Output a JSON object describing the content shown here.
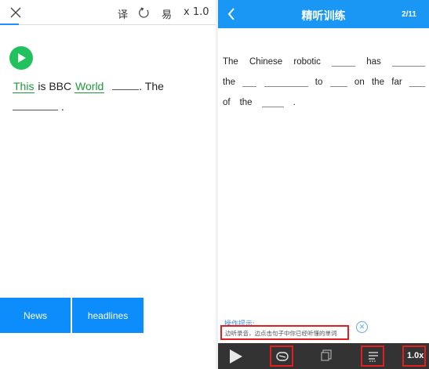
{
  "left": {
    "toolbar": {
      "translate_label": "译",
      "easy_label": "易",
      "speed_label": "x 1.0"
    },
    "sentence": {
      "w1": "This",
      "t1": "is BBC",
      "w2": "World",
      "t2": ". The",
      "t3": "."
    },
    "buttons": [
      "News",
      "headlines"
    ]
  },
  "right": {
    "header": {
      "title": "精听训练",
      "count": "2/11"
    },
    "lines": {
      "l1": [
        "The",
        "Chinese",
        "robotic",
        "has"
      ],
      "l2": [
        "the",
        "to",
        "on",
        "the",
        "far"
      ],
      "l3": [
        "of",
        "the",
        "."
      ]
    },
    "hint": {
      "title": "操作提示:",
      "text": "边听录音，边点击句子中你已经听懂的单词"
    },
    "speed_label": "1.0x"
  },
  "colors": {
    "accent_blue": "#1a97f5",
    "button_blue": "#0d8cfb",
    "play_green": "#21c25e",
    "word_green": "#1d9a3a",
    "highlight_red": "#e02020",
    "bottom_bar": "#333333"
  },
  "icons": [
    "close-icon",
    "refresh-icon",
    "play-icon",
    "back-icon",
    "loop-icon",
    "copy-icon",
    "list-icon"
  ]
}
